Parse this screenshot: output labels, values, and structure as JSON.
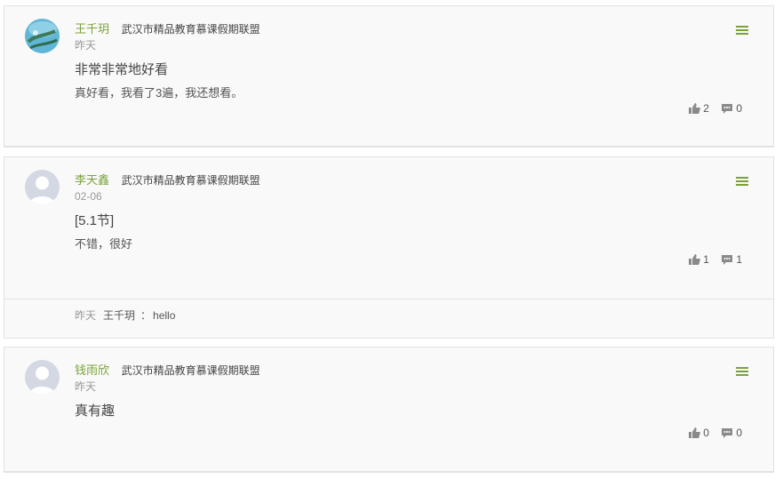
{
  "comments": [
    {
      "username": "王千玥",
      "org": "武汉市精品教育慕课假期联盟",
      "time": "昨天",
      "title": "非常非常地好看",
      "body": "真好看，我看了3遍，我还想看。",
      "likes": "2",
      "replies": "0",
      "avatar": "photo-avatar"
    },
    {
      "username": "李天鑫",
      "org": "武汉市精品教育慕课假期联盟",
      "time": "02-06",
      "title": "[5.1节]",
      "body": "不错，很好",
      "likes": "1",
      "replies": "1",
      "avatar": "default-avatar",
      "reply": {
        "time": "昨天",
        "user": "王千玥",
        "separator": "：",
        "content": "hello"
      }
    },
    {
      "username": "钱雨欣",
      "org": "武汉市精品教育慕课假期联盟",
      "time": "昨天",
      "title": "真有趣",
      "body": "",
      "likes": "0",
      "replies": "0",
      "avatar": "default-avatar"
    }
  ],
  "colors": {
    "accent": "#7aa23a",
    "card_bg": "#f9f9f9",
    "border": "#e2e2e2"
  }
}
